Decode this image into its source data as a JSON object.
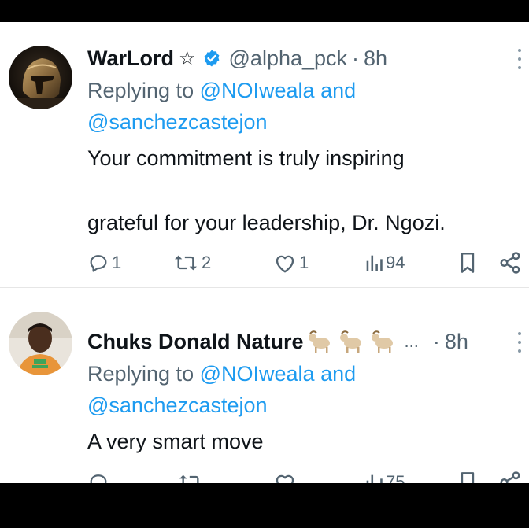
{
  "tweets": [
    {
      "name": "WarLord",
      "name_suffix": "☆",
      "handle": "@alpha_pck",
      "time": "8h",
      "reply_prefix": "Replying to",
      "reply_to_1": "@NOIweala",
      "reply_and": "and",
      "reply_to_2": "@sanchezcastejon",
      "text_line_1": "Your commitment  is truly inspiring",
      "text_line_2": "grateful for your leadership, Dr. Ngozi.",
      "replies": "1",
      "retweets": "2",
      "likes": "1",
      "views": "94"
    },
    {
      "name": "Chuks Donald Nature",
      "emojis": "🐐🐐🐐",
      "ellipsis": "...",
      "time": "8h",
      "reply_prefix": "Replying to",
      "reply_to_1": "@NOIweala",
      "reply_and": "and",
      "reply_to_2": "@sanchezcastejon",
      "text_line_1": "A very smart move",
      "views": "75"
    }
  ],
  "colors": {
    "link": "#1d9bf0",
    "secondary": "#536471",
    "primary_text": "#0f1419",
    "verified": "#1d9bf0"
  },
  "icons": [
    "reply-icon",
    "retweet-icon",
    "like-icon",
    "views-icon",
    "bookmark-icon",
    "share-icon",
    "verified-badge-icon",
    "more-options-icon"
  ]
}
